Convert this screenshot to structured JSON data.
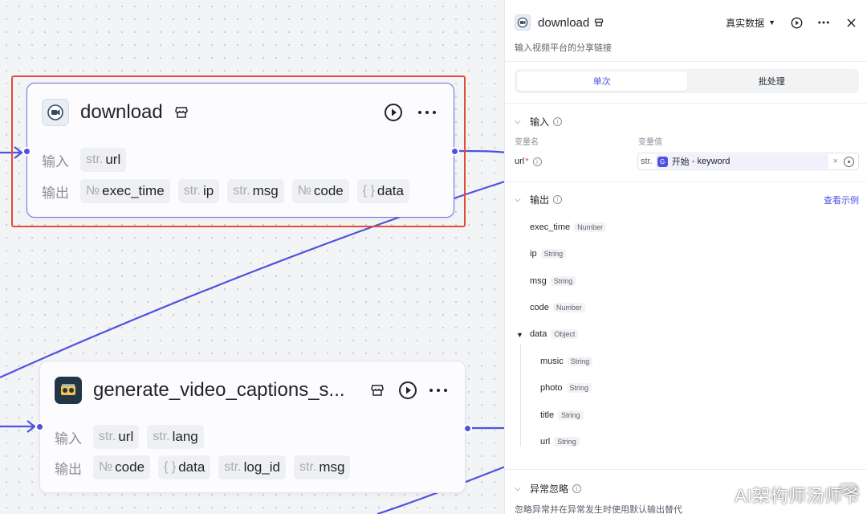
{
  "canvas": {
    "nodes": {
      "download": {
        "title": "download",
        "input_label": "输入",
        "output_label": "输出",
        "inputs": [
          {
            "type": "str.",
            "name": "url"
          }
        ],
        "outputs": [
          {
            "type": "№",
            "name": "exec_time"
          },
          {
            "type": "str.",
            "name": "ip"
          },
          {
            "type": "str.",
            "name": "msg"
          },
          {
            "type": "№",
            "name": "code"
          },
          {
            "type": "{ }",
            "name": "data"
          }
        ]
      },
      "generate": {
        "title": "generate_video_captions_s...",
        "input_label": "输入",
        "output_label": "输出",
        "inputs": [
          {
            "type": "str.",
            "name": "url"
          },
          {
            "type": "str.",
            "name": "lang"
          }
        ],
        "outputs": [
          {
            "type": "№",
            "name": "code"
          },
          {
            "type": "{ }",
            "name": "data"
          },
          {
            "type": "str.",
            "name": "log_id"
          },
          {
            "type": "str.",
            "name": "msg"
          }
        ]
      }
    }
  },
  "panel": {
    "title": "download",
    "data_mode": "真实数据",
    "description": "输入视频平台的分享链接",
    "tabs": [
      {
        "label": "单次",
        "active": true
      },
      {
        "label": "批处理",
        "active": false
      }
    ],
    "input_section": {
      "title": "输入",
      "col_name": "变量名",
      "col_value": "变量值",
      "param": {
        "name": "url",
        "required_mark": "*",
        "type": "str.",
        "ref_node": "开始",
        "ref_sep": " - ",
        "ref_var": "keyword"
      }
    },
    "output_section": {
      "title": "输出",
      "view_example": "查看示例",
      "items": [
        {
          "name": "exec_time",
          "type": "Number"
        },
        {
          "name": "ip",
          "type": "String"
        },
        {
          "name": "msg",
          "type": "String"
        },
        {
          "name": "code",
          "type": "Number"
        },
        {
          "name": "data",
          "type": "Object"
        }
      ],
      "children": [
        {
          "name": "music",
          "type": "String"
        },
        {
          "name": "photo",
          "type": "String"
        },
        {
          "name": "title",
          "type": "String"
        },
        {
          "name": "url",
          "type": "String"
        }
      ]
    },
    "error_section": {
      "title": "异常忽略",
      "description": "忽略异常并在异常发生时使用默认输出替代"
    }
  },
  "watermark": "AI架构师汤师爷",
  "colors": {
    "accent": "#4d53e0",
    "selection": "#e54a35",
    "edge": "#4d53e0"
  }
}
